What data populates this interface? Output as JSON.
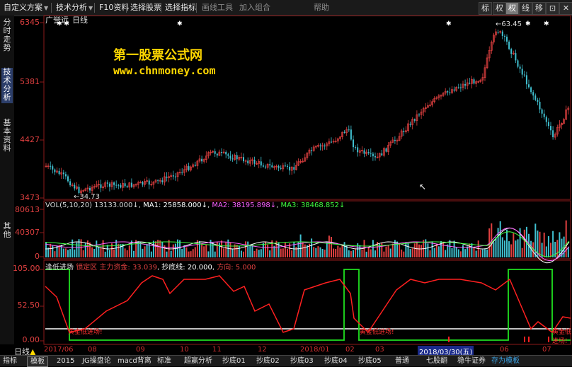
{
  "toolbar": {
    "items": [
      "自定义方案",
      "技术分析",
      "F10资料",
      "选择股票",
      "选择指标",
      "画线工具",
      "加入组合",
      "帮助"
    ],
    "right_buttons": [
      "标",
      "权",
      "权",
      "线",
      "移",
      "⊡",
      "✕"
    ]
  },
  "sidebar": {
    "tabs": [
      "分时走势",
      "技术分析",
      "基本资料",
      "其他"
    ]
  },
  "main_chart": {
    "stock_name": "广誉远",
    "period": "日线",
    "y_ticks": [
      "6345",
      "5381",
      "4427",
      "3473"
    ],
    "high_label": "63.45",
    "low_label": "34.73"
  },
  "watermark": {
    "line1": "第一股票公式网",
    "line2": "www.chnmoney.com"
  },
  "volume_panel": {
    "label": "VOL(5,10,20)",
    "vol": "13133.000",
    "ma1_label": "MA1:",
    "ma1": "25858.000",
    "ma2_label": "MA2:",
    "ma2": "38195.898",
    "ma3_label": "MA3:",
    "ma3": "38468.852",
    "y_ticks": [
      "80613",
      "40307",
      "0"
    ]
  },
  "indicator_panel": {
    "name": "逢低进场",
    "lock_zone": "锁定区",
    "main_fund_label": "主力资金:",
    "main_fund": "33.039",
    "bottom_line_label": "抄底线:",
    "bottom_line": "20.000",
    "direction_label": "方向:",
    "direction": "5.000",
    "y_ticks": [
      "105.00",
      "52.50",
      "0.00"
    ],
    "signal_text": "黄金低进场!"
  },
  "dates": {
    "labels": [
      "2017/06",
      "08",
      "09",
      "10",
      "11",
      "12",
      "2018/01",
      "02",
      "03",
      "2018/03/30(五)",
      "06",
      "07"
    ],
    "period_toggle": "日线"
  },
  "bottom_tabs": [
    "指标",
    "模板",
    "2015",
    "JG操盘论",
    "macd背离",
    "标准",
    "超赢分析",
    "抄底01",
    "抄底02",
    "抄底03",
    "抄底04",
    "抄底05",
    "普通",
    "七股翻",
    "稳牛证券",
    "存为模板"
  ],
  "colors": {
    "up": "#e04040",
    "down": "#40c0d0",
    "axis": "#8b1a1a",
    "label": "#e04040",
    "ma1": "#ffffff",
    "ma2": "#ff60ff",
    "ma3": "#40ff40",
    "fund_line": "#ff2020",
    "lock_line": "#20e020",
    "bottom_line": "#ffffff",
    "watermark": "#ffd700"
  }
}
